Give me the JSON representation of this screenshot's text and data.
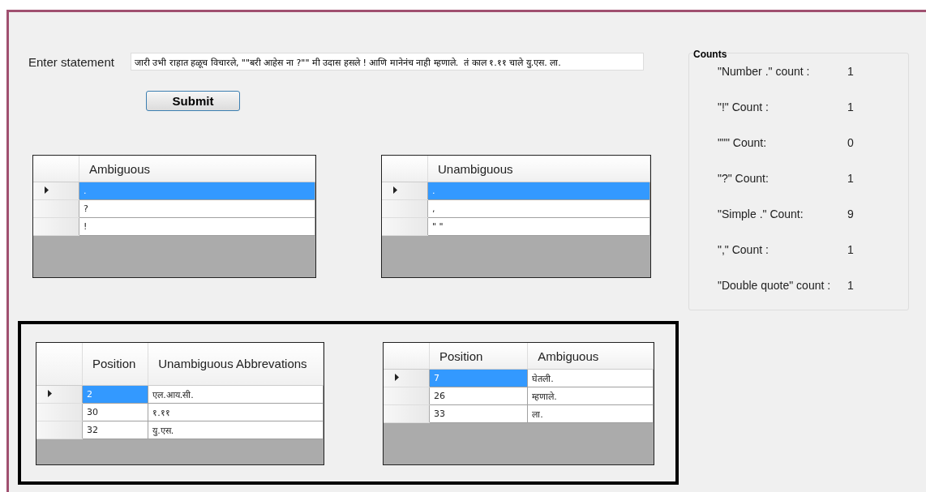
{
  "statement": {
    "label": "Enter statement",
    "value": "जारी उभी राहात हळूच विचारले, \"\"बरी आहेस ना ?\"\" मी उदास हसले ! आणि मानेनंच नाही म्हणाले.  तं काल १.११ चाले यु.एस. ला."
  },
  "submit_button": "Submit",
  "top_grids": [
    {
      "columns": [
        "Ambiguous"
      ],
      "rows": [
        {
          "cells": [
            "."
          ],
          "selected": true
        },
        {
          "cells": [
            "?"
          ],
          "selected": false
        },
        {
          "cells": [
            "!"
          ],
          "selected": false
        }
      ]
    },
    {
      "columns": [
        "Unambiguous"
      ],
      "rows": [
        {
          "cells": [
            "."
          ],
          "selected": true
        },
        {
          "cells": [
            ","
          ],
          "selected": false
        },
        {
          "cells": [
            "\" \""
          ],
          "selected": false
        }
      ]
    }
  ],
  "bottom_grids": [
    {
      "columns": [
        "Position",
        "Unambiguous Abbrevations"
      ],
      "rows": [
        {
          "cells": [
            "2",
            "एल.आय.सी."
          ],
          "selected": true
        },
        {
          "cells": [
            "30",
            "१.११"
          ],
          "selected": false
        },
        {
          "cells": [
            "32",
            "यु.एस."
          ],
          "selected": false
        }
      ]
    },
    {
      "columns": [
        "Position",
        "Ambiguous"
      ],
      "rows": [
        {
          "cells": [
            "7",
            "घेतली."
          ],
          "selected": true
        },
        {
          "cells": [
            "26",
            "म्हणाले."
          ],
          "selected": false
        },
        {
          "cells": [
            "33",
            "ला."
          ],
          "selected": false
        }
      ]
    }
  ],
  "counts": {
    "title": "Counts",
    "items": [
      {
        "label": "\"Number .\" count :",
        "value": "1"
      },
      {
        "label": "\"!\" Count :",
        "value": "1"
      },
      {
        "label": "\"\"\" Count:",
        "value": "0"
      },
      {
        "label": "\"?\" Count:",
        "value": "1"
      },
      {
        "label": "\"Simple .\" Count:",
        "value": "9"
      },
      {
        "label": "\",\" Count :",
        "value": "1"
      },
      {
        "label": "\"Double quote\" count :",
        "value": "1"
      }
    ]
  }
}
